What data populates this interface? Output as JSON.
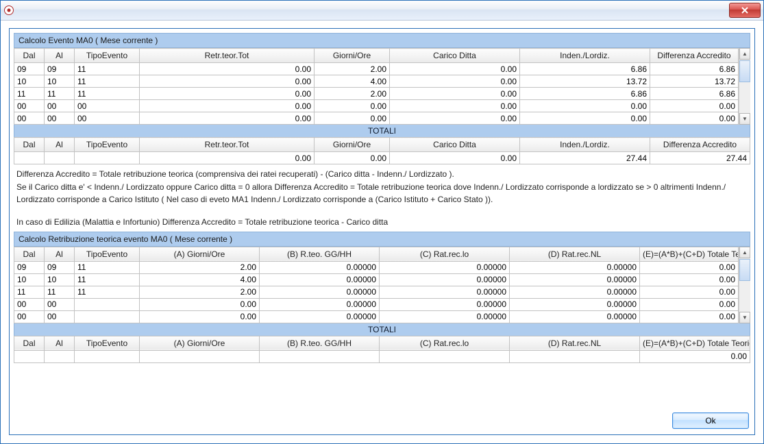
{
  "window": {
    "close_tooltip": "Close"
  },
  "section1": {
    "title": "Calcolo Evento MA0 ( Mese corrente )",
    "cols": [
      "Dal",
      "Al",
      "TipoEvento",
      "Retr.teor.Tot",
      "Giorni/Ore",
      "Carico Ditta",
      "Inden./Lordiz.",
      "Differenza Accredito"
    ],
    "rows": [
      {
        "dal": "09",
        "al": "09",
        "tipo": "11",
        "retr": "0.00",
        "gg": "2.00",
        "cd": "0.00",
        "il": "6.86",
        "da": "6.86"
      },
      {
        "dal": "10",
        "al": "10",
        "tipo": "11",
        "retr": "0.00",
        "gg": "4.00",
        "cd": "0.00",
        "il": "13.72",
        "da": "13.72"
      },
      {
        "dal": "11",
        "al": "11",
        "tipo": "11",
        "retr": "0.00",
        "gg": "2.00",
        "cd": "0.00",
        "il": "6.86",
        "da": "6.86"
      },
      {
        "dal": "00",
        "al": "00",
        "tipo": "00",
        "retr": "0.00",
        "gg": "0.00",
        "cd": "0.00",
        "il": "0.00",
        "da": "0.00"
      },
      {
        "dal": "00",
        "al": "00",
        "tipo": "00",
        "retr": "0.00",
        "gg": "0.00",
        "cd": "0.00",
        "il": "0.00",
        "da": "0.00"
      }
    ],
    "totali_label": "TOTALI",
    "totali_cols": [
      "Dal",
      "Al",
      "TipoEvento",
      "Retr.teor.Tot",
      "Giorni/Ore",
      "Carico Ditta",
      "Inden./Lordiz.",
      "Differenza Accredito"
    ],
    "totali_row": {
      "dal": "",
      "al": "",
      "tipo": "",
      "retr": "0.00",
      "gg": "0.00",
      "cd": "0.00",
      "il": "27.44",
      "da": "27.44"
    }
  },
  "explain": {
    "p1": "Differenza Accredito = Totale retribuzione teorica (comprensiva dei ratei recuperati) - (Carico ditta - Indenn./ Lordizzato ).",
    "p2": "Se il Carico ditta e' < Indenn./ Lordizzato oppure Carico ditta = 0 allora Differenza Accredito = Totale retribuzione teorica dove Indenn./ Lordizzato corrisponde a lordizzato se > 0 altrimenti Indenn./ Lordizzato corrisponde a Carico Istituto ( Nel caso di eveto MA1 Indenn./ Lordizzato corrisponde a (Carico Istituto + Carico Stato )).",
    "p3": "In caso di Edilizia (Malattia e Infortunio) Differenza Accredito = Totale retribuzione teorica - Carico ditta"
  },
  "section2": {
    "title": "Calcolo Retribuzione teorica evento MA0 ( Mese corrente )",
    "cols": [
      "Dal",
      "Al",
      "TipoEvento",
      "(A) Giorni/Ore",
      "(B) R.teo. GG/HH",
      "(C) Rat.rec.lo",
      "(D) Rat.rec.NL",
      "(E)=(A*B)+(C+D) Totale Teorica"
    ],
    "rows": [
      {
        "dal": "09",
        "al": "09",
        "tipo": "11",
        "a": "2.00",
        "b": "0.00000",
        "c": "0.00000",
        "d": "0.00000",
        "e": "0.00"
      },
      {
        "dal": "10",
        "al": "10",
        "tipo": "11",
        "a": "4.00",
        "b": "0.00000",
        "c": "0.00000",
        "d": "0.00000",
        "e": "0.00"
      },
      {
        "dal": "11",
        "al": "11",
        "tipo": "11",
        "a": "2.00",
        "b": "0.00000",
        "c": "0.00000",
        "d": "0.00000",
        "e": "0.00"
      },
      {
        "dal": "00",
        "al": "00",
        "tipo": "",
        "a": "0.00",
        "b": "0.00000",
        "c": "0.00000",
        "d": "0.00000",
        "e": "0.00"
      },
      {
        "dal": "00",
        "al": "00",
        "tipo": "",
        "a": "0.00",
        "b": "0.00000",
        "c": "0.00000",
        "d": "0.00000",
        "e": "0.00"
      }
    ],
    "totali_label": "TOTALI",
    "totali_cols": [
      "Dal",
      "Al",
      "TipoEvento",
      "(A) Giorni/Ore",
      "(B) R.teo. GG/HH",
      "(C) Rat.rec.lo",
      "(D) Rat.rec.NL",
      "(E)=(A*B)+(C+D) Totale Teorica"
    ],
    "totali_row": {
      "dal": "",
      "al": "",
      "tipo": "",
      "a": "",
      "b": "",
      "c": "",
      "d": "",
      "e": "0.00"
    }
  },
  "buttons": {
    "ok": "Ok"
  }
}
